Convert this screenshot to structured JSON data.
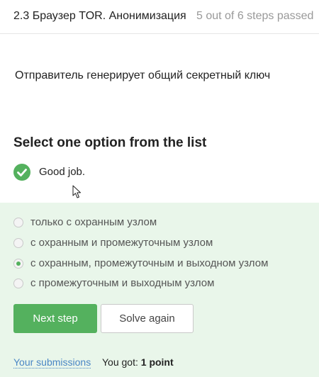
{
  "header": {
    "lesson_title": "2.3 Браузер TOR. Анонимизация",
    "progress": "5 out of 6 steps passed"
  },
  "question": "Отправитель генерирует общий секретный ключ",
  "quiz": {
    "heading": "Select one option from the list",
    "feedback": "Good job.",
    "options": [
      {
        "label": "только с охранным узлом",
        "selected": false
      },
      {
        "label": "с охранным и промежуточным узлом",
        "selected": false
      },
      {
        "label": "с охранным, промежуточным и выходном узлом",
        "selected": true
      },
      {
        "label": "с промежуточным и выходным узлом",
        "selected": false
      }
    ]
  },
  "actions": {
    "next_label": "Next step",
    "solve_again_label": "Solve again"
  },
  "footer": {
    "submissions_label": "Your submissions",
    "score_prefix": "You got: ",
    "score_value": "1 point"
  },
  "colors": {
    "accent_green": "#54b15e",
    "panel_bg": "#e9f6ea",
    "link_blue": "#4a86c5"
  },
  "icons": {
    "feedback": "check-circle-icon",
    "cursor": "mouse-pointer-icon"
  }
}
